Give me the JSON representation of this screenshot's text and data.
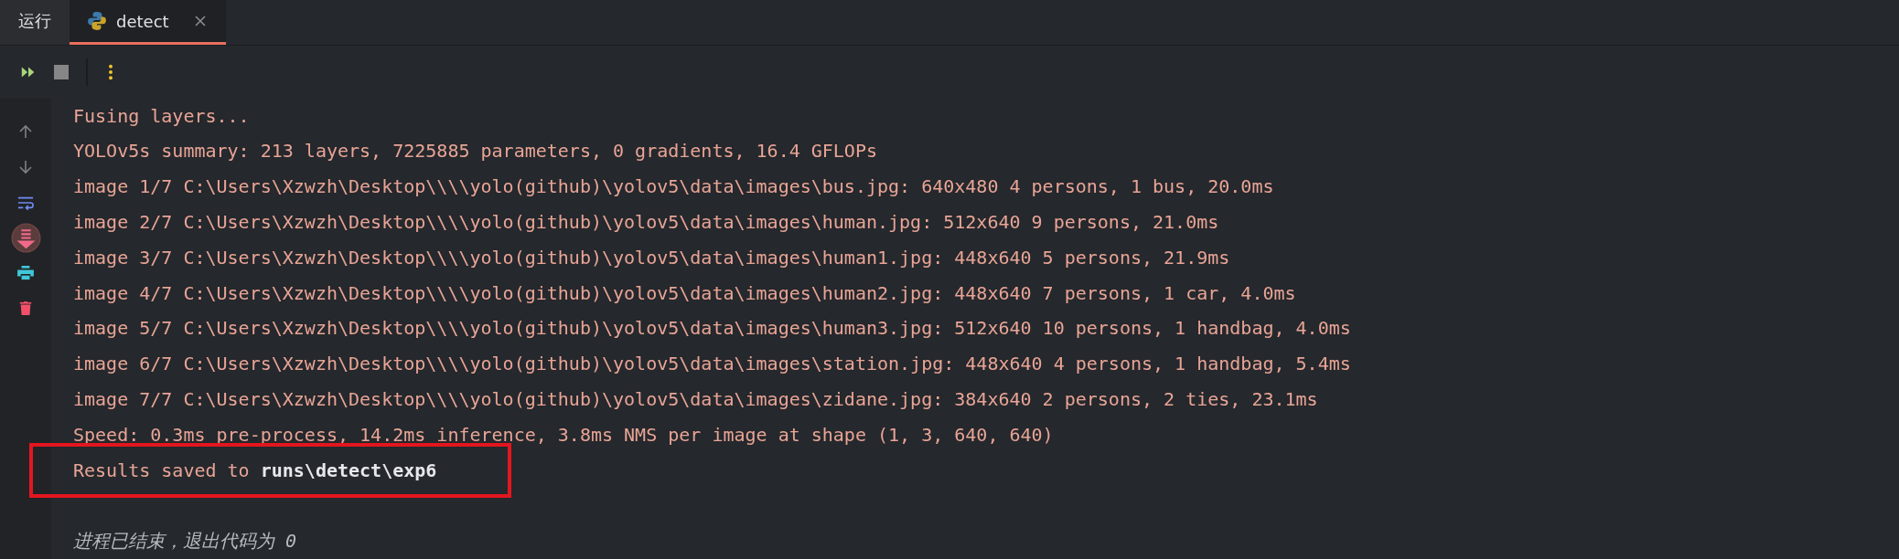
{
  "tabs": [
    {
      "label": "运行",
      "selected": false,
      "closable": false
    },
    {
      "label": "detect",
      "selected": true,
      "closable": true
    }
  ],
  "console": {
    "lines": [
      {
        "kind": "output",
        "text": "Fusing layers..."
      },
      {
        "kind": "output",
        "text": "YOLOv5s summary: 213 layers, 7225885 parameters, 0 gradients, 16.4 GFLOPs"
      },
      {
        "kind": "output",
        "text": "image 1/7 C:\\Users\\Xzwzh\\Desktop\\\\\\\\yolo(github)\\yolov5\\data\\images\\bus.jpg: 640x480 4 persons, 1 bus, 20.0ms"
      },
      {
        "kind": "output",
        "text": "image 2/7 C:\\Users\\Xzwzh\\Desktop\\\\\\\\yolo(github)\\yolov5\\data\\images\\human.jpg: 512x640 9 persons, 21.0ms"
      },
      {
        "kind": "output",
        "text": "image 3/7 C:\\Users\\Xzwzh\\Desktop\\\\\\\\yolo(github)\\yolov5\\data\\images\\human1.jpg: 448x640 5 persons, 21.9ms"
      },
      {
        "kind": "output",
        "text": "image 4/7 C:\\Users\\Xzwzh\\Desktop\\\\\\\\yolo(github)\\yolov5\\data\\images\\human2.jpg: 448x640 7 persons, 1 car, 4.0ms"
      },
      {
        "kind": "output",
        "text": "image 5/7 C:\\Users\\Xzwzh\\Desktop\\\\\\\\yolo(github)\\yolov5\\data\\images\\human3.jpg: 512x640 10 persons, 1 handbag, 4.0ms"
      },
      {
        "kind": "output",
        "text": "image 6/7 C:\\Users\\Xzwzh\\Desktop\\\\\\\\yolo(github)\\yolov5\\data\\images\\station.jpg: 448x640 4 persons, 1 handbag, 5.4ms"
      },
      {
        "kind": "output",
        "text": "image 7/7 C:\\Users\\Xzwzh\\Desktop\\\\\\\\yolo(github)\\yolov5\\data\\images\\zidane.jpg: 384x640 2 persons, 2 ties, 23.1ms"
      },
      {
        "kind": "output",
        "text": "Speed: 0.3ms pre-process, 14.2ms inference, 3.8ms NMS per image at shape (1, 3, 640, 640)"
      },
      {
        "kind": "output",
        "text": "Results saved to **runs\\detect\\exp6**",
        "highlighted": true
      },
      {
        "kind": "exit",
        "text": "进程已结束，退出代码为 0"
      }
    ]
  }
}
